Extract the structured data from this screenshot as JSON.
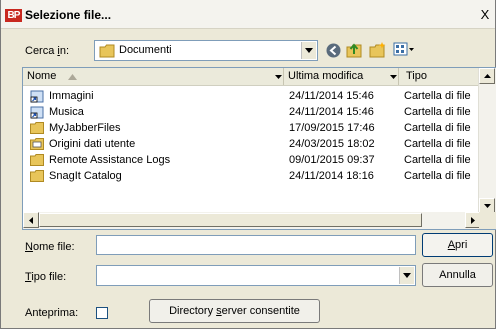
{
  "window": {
    "title": "Selezione file...",
    "app_icon_text": "BP",
    "close_label": "X"
  },
  "look_in": {
    "label_pre": "Cerca ",
    "label_key": "i",
    "label_post": "n:",
    "value": "Documenti"
  },
  "toolbar_icons": [
    "back-icon",
    "up-folder-icon",
    "new-folder-icon",
    "view-menu-icon"
  ],
  "columns": [
    {
      "label": "Nome",
      "sort": "ascending"
    },
    {
      "label": "Ultima modifica"
    },
    {
      "label": "Tipo"
    }
  ],
  "files": [
    {
      "name": "Immagini",
      "modified": "24/11/2014 15:46",
      "type": "Cartella di file",
      "icon": "shortcut-folder-icon"
    },
    {
      "name": "Musica",
      "modified": "24/11/2014 15:46",
      "type": "Cartella di file",
      "icon": "shortcut-folder-icon"
    },
    {
      "name": "MyJabberFiles",
      "modified": "17/09/2015 17:46",
      "type": "Cartella di file",
      "icon": "folder-icon"
    },
    {
      "name": "Origini dati utente",
      "modified": "24/03/2015 18:02",
      "type": "Cartella di file",
      "icon": "data-sources-folder-icon"
    },
    {
      "name": "Remote Assistance Logs",
      "modified": "09/01/2015 09:37",
      "type": "Cartella di file",
      "icon": "folder-icon"
    },
    {
      "name": "SnagIt Catalog",
      "modified": "24/11/2014 18:16",
      "type": "Cartella di file",
      "icon": "folder-icon"
    }
  ],
  "file_name": {
    "label_key": "N",
    "label_rest": "ome file:",
    "value": ""
  },
  "file_type": {
    "label_key": "T",
    "label_rest": "ipo file:",
    "value": ""
  },
  "buttons": {
    "open": {
      "key": "A",
      "rest": "pri"
    },
    "cancel": "Annulla",
    "directory": {
      "pre": "Directory ",
      "key": "s",
      "post": "erver consentite"
    }
  },
  "preview": {
    "label": "Anteprima:",
    "checked": false
  }
}
